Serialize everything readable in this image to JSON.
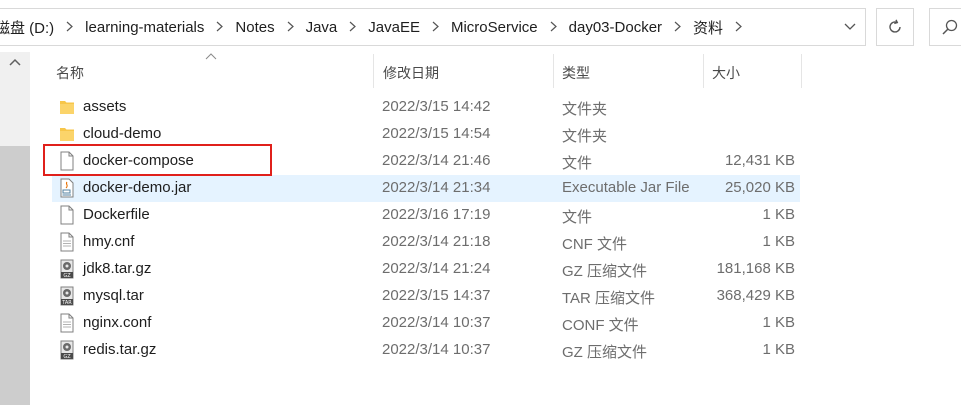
{
  "breadcrumb": [
    {
      "label": "磁盘 (D:)"
    },
    {
      "label": "learning-materials"
    },
    {
      "label": "Notes"
    },
    {
      "label": "Java"
    },
    {
      "label": "JavaEE"
    },
    {
      "label": "MicroService"
    },
    {
      "label": "day03-Docker"
    },
    {
      "label": "资料"
    }
  ],
  "icons": {
    "dropdown": "chevron-down-icon",
    "refresh": "refresh-icon",
    "search": "search-icon",
    "scroll_up": "scroll-up-icon"
  },
  "columns": {
    "name": "名称",
    "date": "修改日期",
    "type": "类型",
    "size": "大小"
  },
  "files": [
    {
      "name": "assets",
      "date": "2022/3/15 14:42",
      "type": "文件夹",
      "size": "",
      "icon": "folder-icon"
    },
    {
      "name": "cloud-demo",
      "date": "2022/3/15 14:54",
      "type": "文件夹",
      "size": "",
      "icon": "folder-icon"
    },
    {
      "name": "docker-compose",
      "date": "2022/3/14 21:46",
      "type": "文件",
      "size": "12,431 KB",
      "icon": "file-icon",
      "highlighted": true
    },
    {
      "name": "docker-demo.jar",
      "date": "2022/3/14 21:34",
      "type": "Executable Jar File",
      "size": "25,020 KB",
      "icon": "java-jar-icon",
      "selected": true
    },
    {
      "name": "Dockerfile",
      "date": "2022/3/16 17:19",
      "type": "文件",
      "size": "1 KB",
      "icon": "file-icon"
    },
    {
      "name": "hmy.cnf",
      "date": "2022/3/14 21:18",
      "type": "CNF 文件",
      "size": "1 KB",
      "icon": "text-file-icon"
    },
    {
      "name": "jdk8.tar.gz",
      "date": "2022/3/14 21:24",
      "type": "GZ 压缩文件",
      "size": "181,168 KB",
      "icon": "gz-archive-icon"
    },
    {
      "name": "mysql.tar",
      "date": "2022/3/15 14:37",
      "type": "TAR 压缩文件",
      "size": "368,429 KB",
      "icon": "tar-archive-icon"
    },
    {
      "name": "nginx.conf",
      "date": "2022/3/14 10:37",
      "type": "CONF 文件",
      "size": "1 KB",
      "icon": "text-file-icon"
    },
    {
      "name": "redis.tar.gz",
      "date": "2022/3/14 10:37",
      "type": "GZ 压缩文件",
      "size": "1 KB",
      "icon": "gz-archive-icon"
    }
  ],
  "colors": {
    "selection": "#e5f3ff",
    "highlight_box": "#e0201b",
    "folder": "#f7c64a"
  }
}
